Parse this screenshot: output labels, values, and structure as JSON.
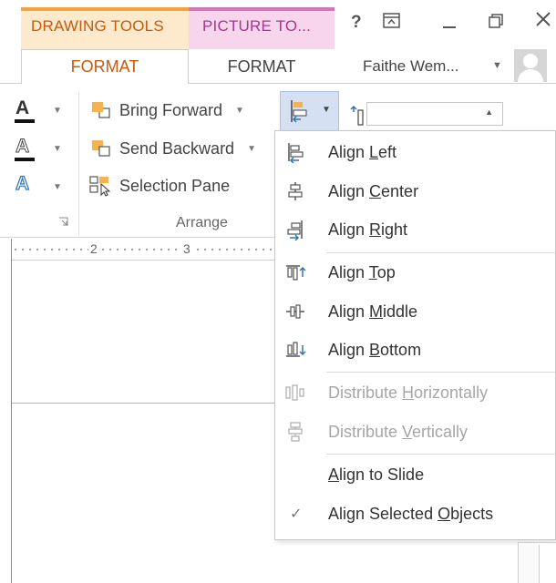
{
  "header": {
    "context_tabs": [
      {
        "label": "DRAWING TOOLS",
        "color": "#c55a11"
      },
      {
        "label": "PICTURE TO...",
        "color": "#a4398d"
      }
    ],
    "tabs": [
      {
        "label": "FORMAT",
        "active": true
      },
      {
        "label": "FORMAT",
        "active": false
      }
    ],
    "window_controls": {
      "help": "?"
    },
    "user": {
      "name": "Faithe Wem..."
    }
  },
  "ribbon": {
    "format_icons": [
      "text-fill-icon",
      "text-outline-icon",
      "text-effects-icon"
    ],
    "arrange": {
      "group_label": "Arrange",
      "commands": [
        {
          "label": "Bring Forward",
          "icon": "bring-forward-icon"
        },
        {
          "label": "Send Backward",
          "icon": "send-backward-icon"
        },
        {
          "label": "Selection Pane",
          "icon": "selection-pane-icon"
        }
      ]
    },
    "align_button_icon": "align-icon",
    "size_input": {
      "value": ""
    }
  },
  "ruler": {
    "labels": [
      "2",
      "3"
    ]
  },
  "align_menu": {
    "items": [
      {
        "label_pre": "Align ",
        "key": "L",
        "label_post": "eft",
        "icon": "align-left-icon",
        "enabled": true
      },
      {
        "label_pre": "Align ",
        "key": "C",
        "label_post": "enter",
        "icon": "align-center-icon",
        "enabled": true
      },
      {
        "label_pre": "Align ",
        "key": "R",
        "label_post": "ight",
        "icon": "align-right-icon",
        "enabled": true
      },
      {
        "label_pre": "Align ",
        "key": "T",
        "label_post": "op",
        "icon": "align-top-icon",
        "enabled": true
      },
      {
        "label_pre": "Align ",
        "key": "M",
        "label_post": "iddle",
        "icon": "align-middle-icon",
        "enabled": true
      },
      {
        "label_pre": "Align ",
        "key": "B",
        "label_post": "ottom",
        "icon": "align-bottom-icon",
        "enabled": true
      },
      {
        "label_pre": "Distribute ",
        "key": "H",
        "label_post": "orizontally",
        "icon": "distribute-horizontally-icon",
        "enabled": false
      },
      {
        "label_pre": "Distribute ",
        "key": "V",
        "label_post": "ertically",
        "icon": "distribute-vertically-icon",
        "enabled": false
      },
      {
        "label_pre": "",
        "key": "A",
        "label_post": "lign to Slide",
        "icon": "",
        "enabled": true
      },
      {
        "label_pre": "Align Selected ",
        "key": "O",
        "label_post": "bjects",
        "icon": "check-icon",
        "enabled": true,
        "checked": true
      }
    ]
  },
  "colors": {
    "accent_blue": "#2e75b6",
    "drawing_tools_bg": "#fde9cc",
    "picture_tools_bg": "#f7d5ec",
    "align_button_bg": "#d5e1f2"
  }
}
